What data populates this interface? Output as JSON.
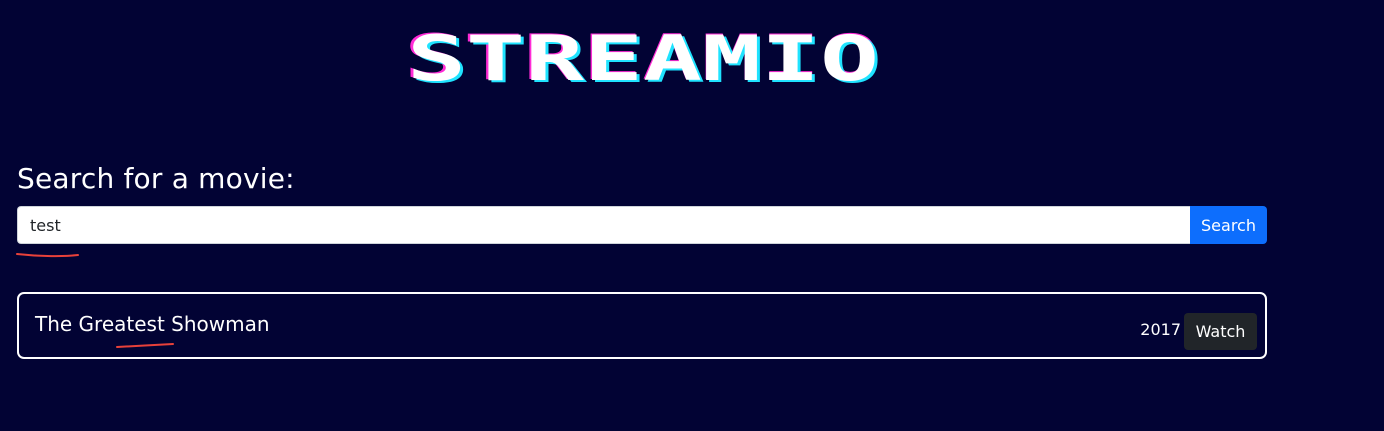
{
  "logo": {
    "text": "STREAMIO",
    "colors": {
      "face": "#ffffff",
      "shadow_magenta": "#ff2bd6",
      "shadow_cyan": "#1fe3ff"
    }
  },
  "search": {
    "label": "Search for a movie:",
    "value": "test",
    "button_label": "Search",
    "accent_color": "#0d6efd"
  },
  "results": [
    {
      "title": "The Greatest Showman",
      "year": "2017",
      "action_label": "Watch"
    }
  ],
  "colors": {
    "background": "#020334",
    "annotation_mark": "#e8413a"
  }
}
